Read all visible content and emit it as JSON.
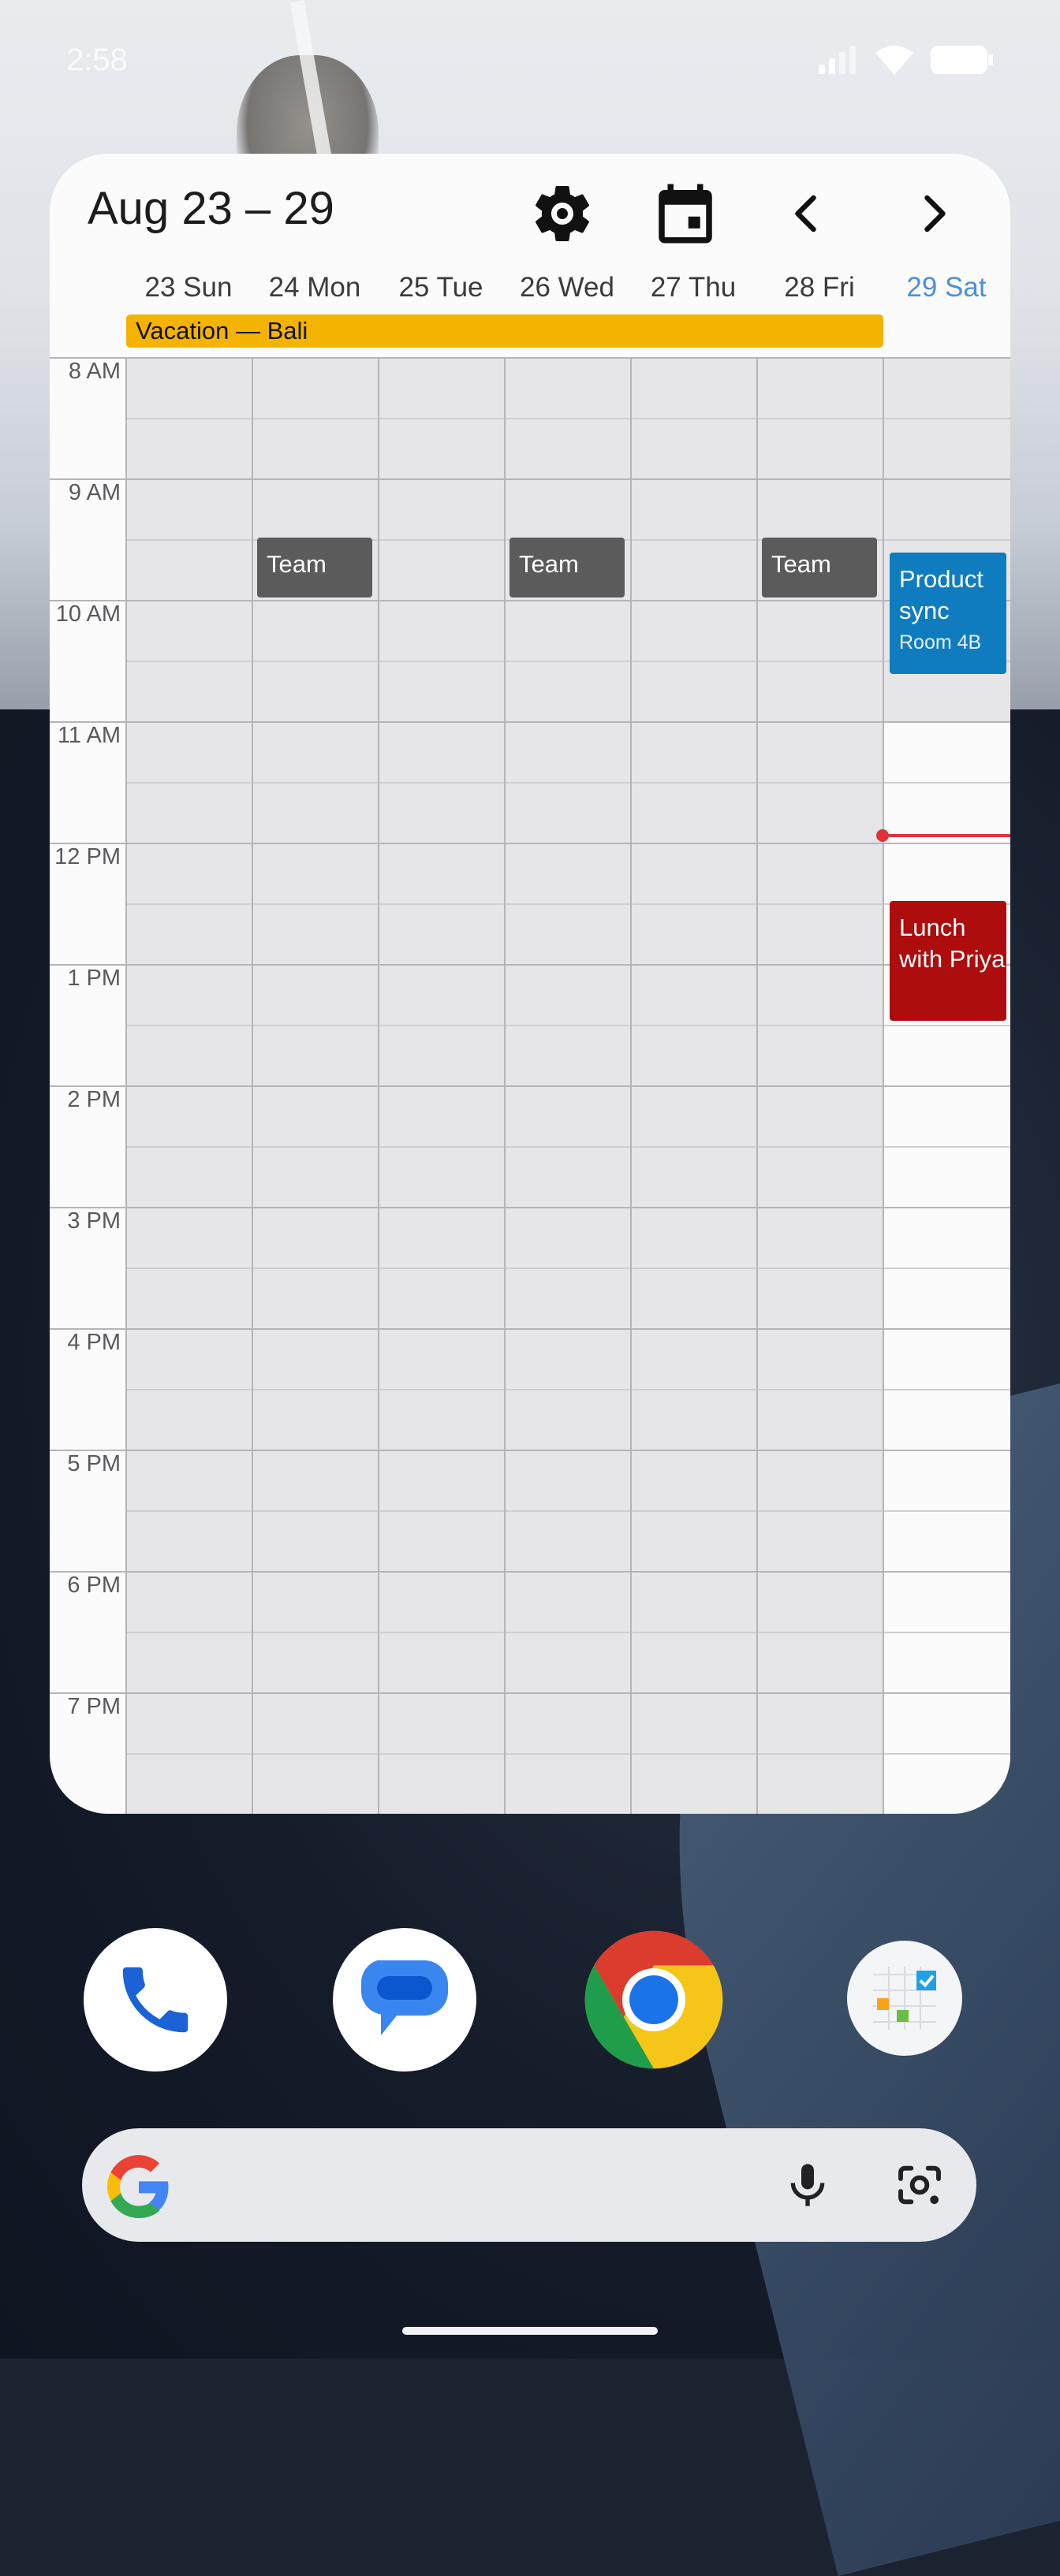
{
  "status_bar": {
    "time": "2:58"
  },
  "widget": {
    "title": "Aug 23 – 29",
    "days": [
      {
        "label": "23 Sun",
        "today": false
      },
      {
        "label": "24 Mon",
        "today": false
      },
      {
        "label": "25 Tue",
        "today": false
      },
      {
        "label": "26 Wed",
        "today": false
      },
      {
        "label": "27 Thu",
        "today": false
      },
      {
        "label": "28 Fri",
        "today": false
      },
      {
        "label": "29 Sat",
        "today": true
      }
    ],
    "all_day_event": "Vacation — Bali",
    "hours": [
      "8 AM",
      "9 AM",
      "10 AM",
      "11 AM",
      "12 PM",
      "1 PM",
      "2 PM",
      "3 PM",
      "4 PM",
      "5 PM",
      "6 PM",
      "7 PM"
    ],
    "events": {
      "team": "Team",
      "product_sync_title": "Product sync",
      "product_sync_location": "Room 4B",
      "lunch": "Lunch with Priya"
    },
    "colors": {
      "vacation": "#f3b300",
      "team": "#5b5b5b",
      "product_sync": "#0f7cbf",
      "lunch": "#ad0d0d",
      "today": "#4a90d9",
      "now_line": "#e0333a"
    }
  },
  "dock": {
    "apps": [
      "phone-icon",
      "messages-icon",
      "chrome-icon",
      "calendar-widget-app-icon"
    ]
  },
  "search_bar": {
    "icons": [
      "google-g-icon",
      "microphone-icon",
      "lens-camera-icon"
    ]
  }
}
